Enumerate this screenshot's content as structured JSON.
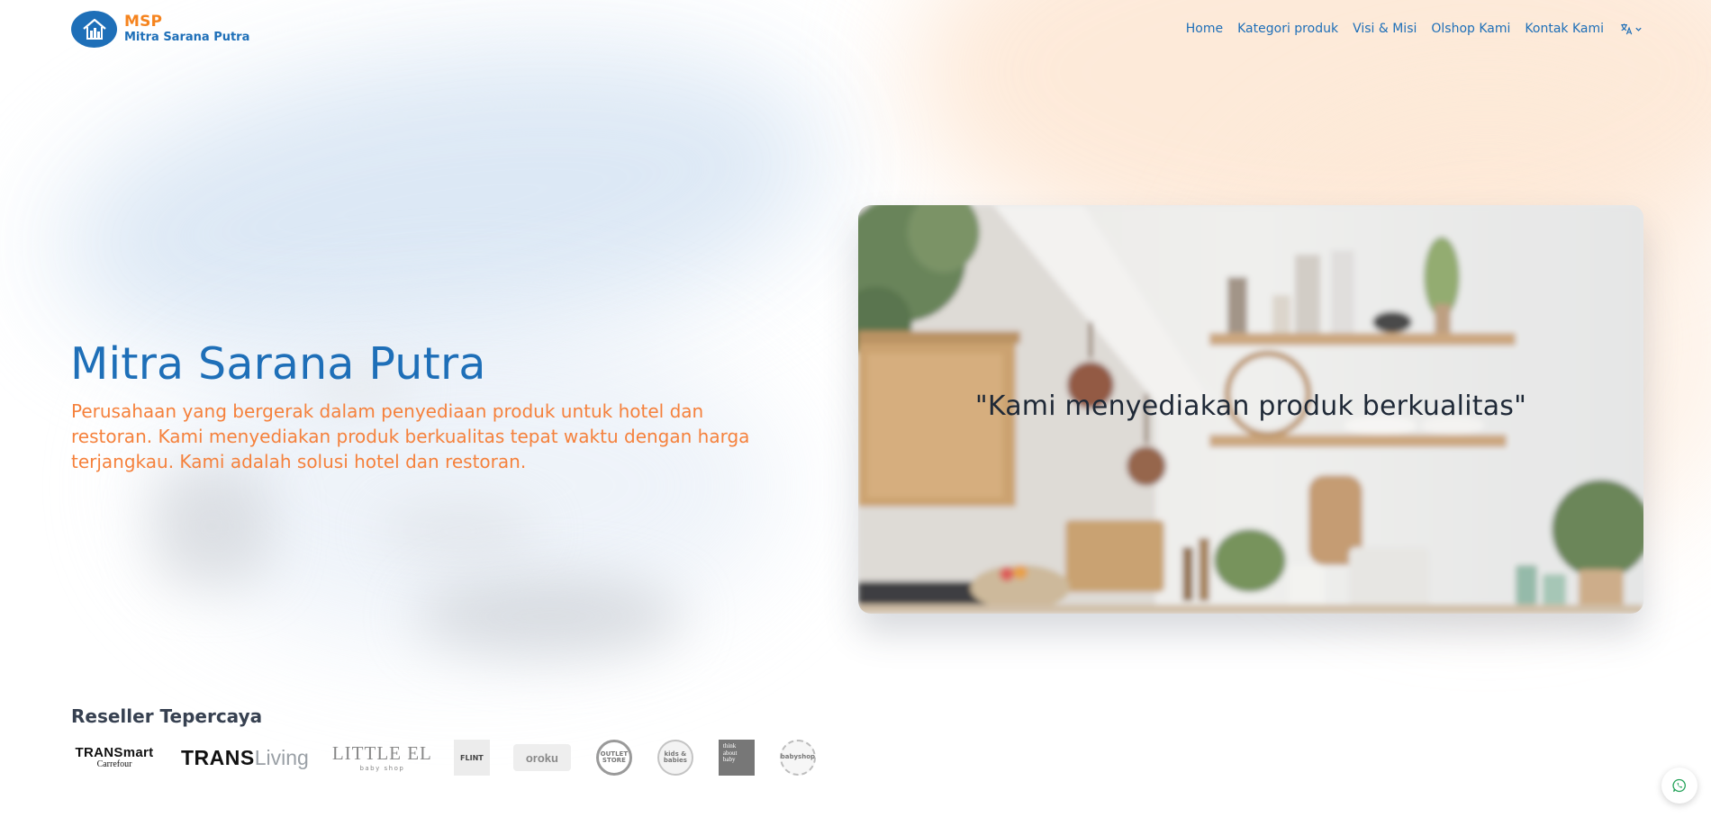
{
  "brand": {
    "short": "MSP",
    "full": "Mitra Sarana Putra",
    "logo_icon": "building-house-icon",
    "colors": {
      "primary": "#1e6fb8",
      "accent": "#f5841f"
    }
  },
  "nav": {
    "items": [
      {
        "label": "Home"
      },
      {
        "label": "Kategori produk"
      },
      {
        "label": "Visi & Misi"
      },
      {
        "label": "Olshop Kami"
      },
      {
        "label": "Kontak Kami"
      }
    ],
    "language_icon": "translate-icon",
    "language_chevron": "chevron-down-icon"
  },
  "hero": {
    "title": "Mitra Sarana Putra",
    "description": "Perusahaan yang bergerak dalam penyediaan produk untuk hotel dan restoran. Kami menyediakan produk berkualitas tepat waktu dengan harga terjangkau. Kami adalah solusi hotel dan restoran.",
    "quote": "\"Kami menyediakan produk berkualitas\""
  },
  "resellers": {
    "title": "Reseller Tepercaya",
    "logos": {
      "transmart": {
        "line1": "TRANSmart",
        "line2": "Carrefour"
      },
      "transliving": {
        "bold": "TRANS",
        "light": "Living"
      },
      "littleel": {
        "main": "LITTLE EL",
        "sub": "baby shop"
      },
      "flint": {
        "label": "FLINT"
      },
      "oroku": {
        "label": "oroku"
      },
      "outlet": {
        "label": "OUTLET STORE"
      },
      "round2": {
        "label": "kids & babies"
      },
      "think": {
        "label": "think about baby"
      },
      "round3": {
        "label": "babyshop"
      }
    }
  },
  "fab": {
    "icon": "whatsapp-icon"
  }
}
